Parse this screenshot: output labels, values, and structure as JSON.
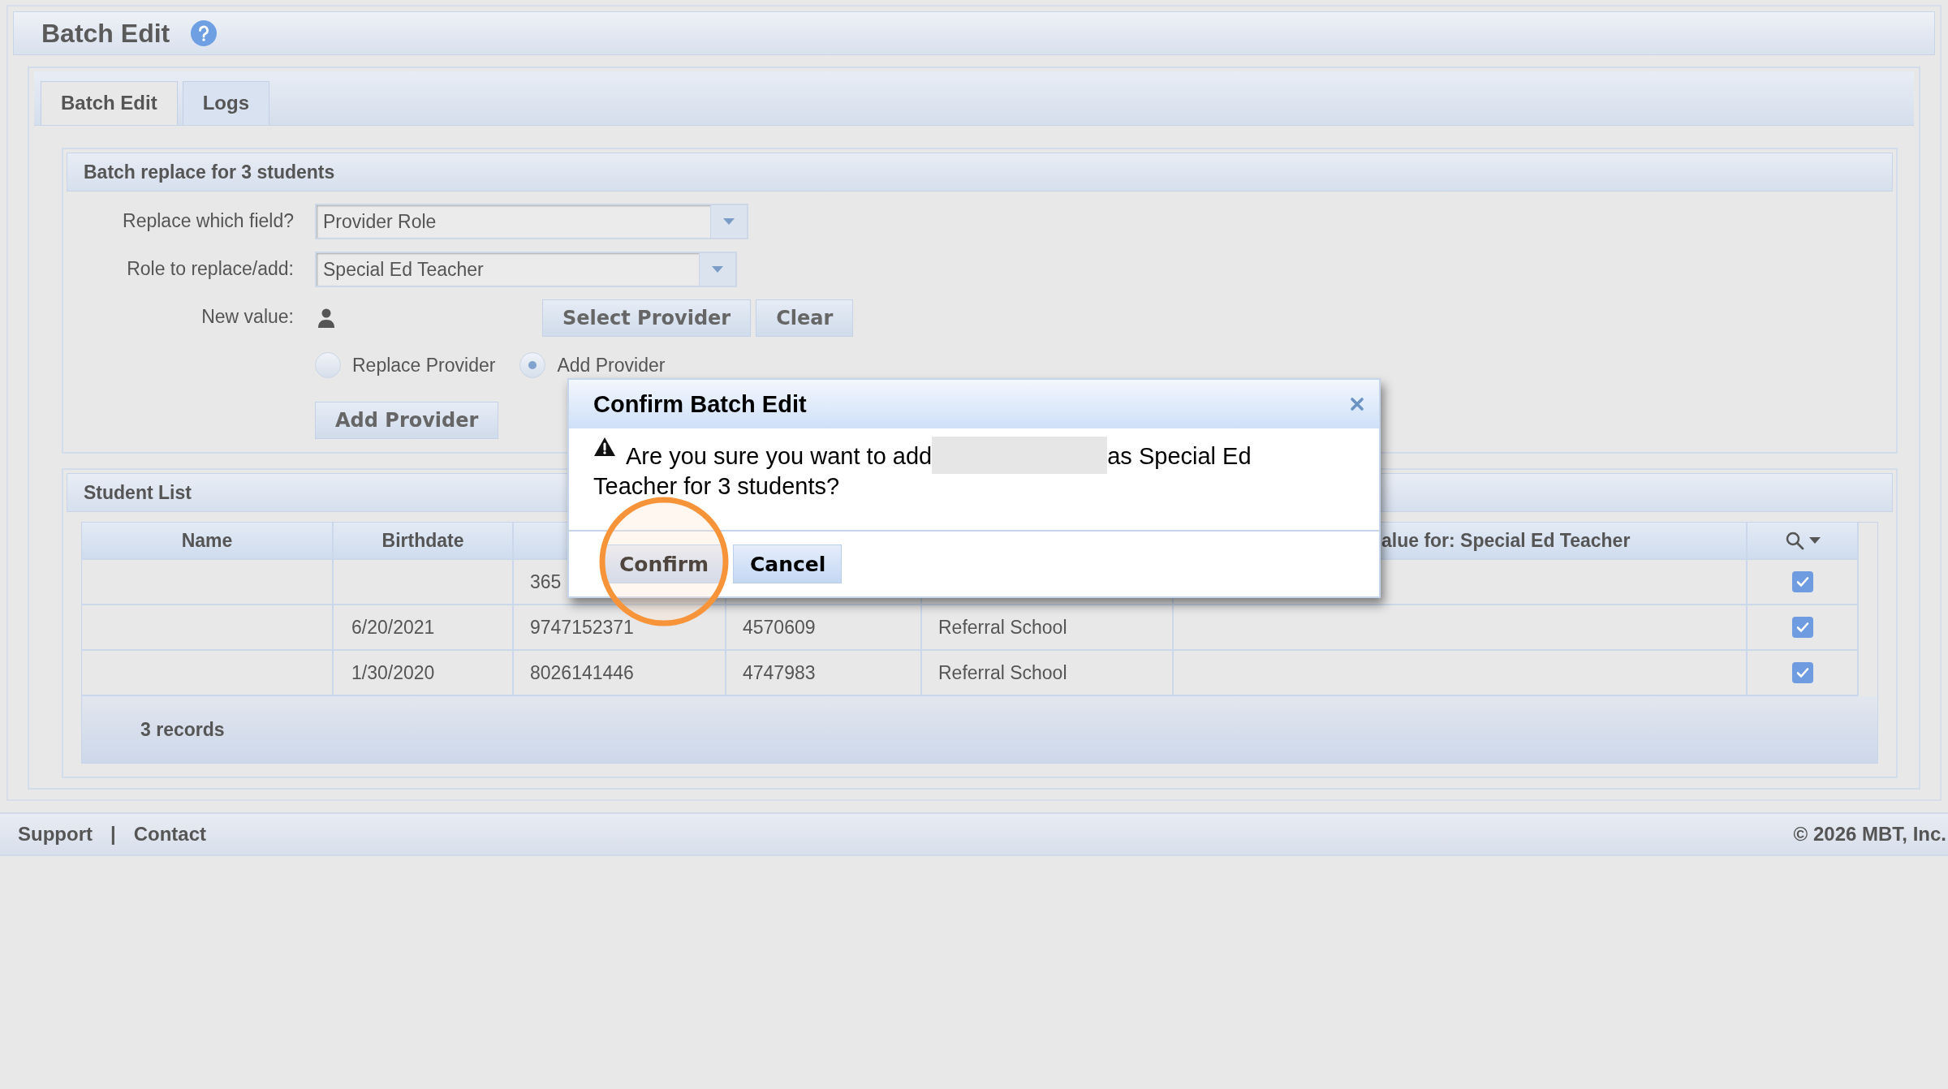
{
  "page_title": "Batch Edit",
  "tabs": [
    {
      "label": "Batch Edit",
      "selected": true
    },
    {
      "label": "Logs",
      "selected": false
    }
  ],
  "batch_section": {
    "title": "Batch replace for 3 students",
    "fields": [
      {
        "label": "Replace which field?",
        "kind": "dropdown",
        "value": "Provider Role"
      },
      {
        "label": "Role to replace/add:",
        "kind": "dropdown",
        "value": "Special Ed Teacher"
      },
      {
        "label": "New value:",
        "kind": "provider",
        "buttons": [
          "Select Provider",
          "Clear"
        ]
      }
    ],
    "options": [
      {
        "label": "Replace Provider",
        "selected": false
      },
      {
        "label": "Add Provider",
        "selected": true
      }
    ],
    "submit_button": "Add Provider"
  },
  "student_list": {
    "title": "Student List",
    "columns": [
      "Name",
      "Birthdate",
      null,
      null,
      null,
      "alue for: Special Ed Teacher"
    ],
    "rows": [
      {
        "cells": [
          null,
          null,
          "365",
          null,
          null,
          null
        ],
        "checked": true
      },
      {
        "cells": [
          null,
          "6/20/2021",
          "9747152371",
          "4570609",
          "Referral School",
          null
        ],
        "checked": true
      },
      {
        "cells": [
          null,
          "1/30/2020",
          "8026141446",
          "4747983",
          "Referral School",
          null
        ],
        "checked": true
      }
    ],
    "record_count": "3 records"
  },
  "footer": {
    "links": [
      "Support",
      "Contact"
    ],
    "separator": "|",
    "copyright": "© 2026 MBT, Inc."
  },
  "dialog": {
    "title": "Confirm Batch Edit",
    "message_before": "Are you sure you want to add",
    "message_after": "as Special Ed Teacher for 3 students?",
    "buttons": [
      "Confirm",
      "Cancel"
    ]
  }
}
